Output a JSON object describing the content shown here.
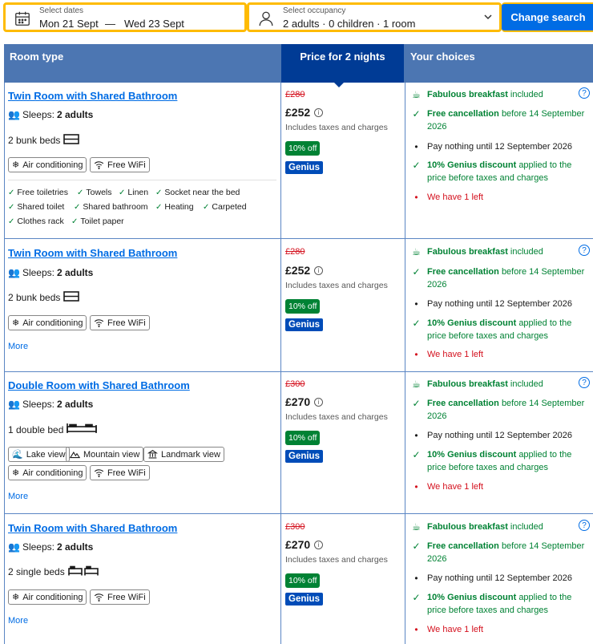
{
  "search": {
    "dates_label": "Select dates",
    "check_in": "Mon 21 Sept",
    "dash": "—",
    "check_out": "Wed 23 Sept",
    "occupancy_label": "Select occupancy",
    "occupancy_value": "2 adults · 0 children · 1 room",
    "button": "Change search"
  },
  "table": {
    "col_type": "Room type",
    "col_price": "Price for 2 nights",
    "col_choices": "Your choices"
  },
  "rooms": [
    {
      "name": "Twin Room with Shared Bathroom",
      "sleeps_label": "Sleeps:",
      "sleeps_value": "2 adults",
      "beds": "2 bunk beds",
      "badges": [
        "Air conditioning",
        "Free WiFi"
      ],
      "facilities": [
        "Free toiletries",
        "Towels",
        "Linen",
        "Socket near the bed",
        "Shared toilet",
        "Shared bathroom",
        "Heating",
        "Carpeted",
        "Clothes rack",
        "Toilet paper"
      ],
      "old_price": "£280",
      "price": "£252",
      "taxes": "Includes taxes and charges",
      "discount": "10% off",
      "genius": "Genius",
      "breakfast_bold": "Fabulous breakfast",
      "breakfast_rest": "included",
      "cancel_bold": "Free cancellation",
      "cancel_rest": "before 14 September 2026",
      "pay": "Pay nothing until 12 September 2026",
      "genius_bold": "10% Genius discount",
      "genius_rest": "applied to the price before taxes and charges",
      "left": "We have 1 left"
    },
    {
      "name": "Twin Room with Shared Bathroom",
      "sleeps_label": "Sleeps:",
      "sleeps_value": "2 adults",
      "beds": "2 bunk beds",
      "badges": [
        "Air conditioning",
        "Free WiFi"
      ],
      "more": "More",
      "old_price": "£280",
      "price": "£252",
      "taxes": "Includes taxes and charges",
      "discount": "10% off",
      "genius": "Genius",
      "breakfast_bold": "Fabulous breakfast",
      "breakfast_rest": "included",
      "cancel_bold": "Free cancellation",
      "cancel_rest": "before 14 September 2026",
      "pay": "Pay nothing until 12 September 2026",
      "genius_bold": "10% Genius discount",
      "genius_rest": "applied to the price before taxes and charges",
      "left": "We have 1 left"
    },
    {
      "name": "Double Room with Shared Bathroom",
      "sleeps_label": "Sleeps:",
      "sleeps_value": "2 adults",
      "beds": "1 double bed",
      "badges": [
        "Lake view",
        "Mountain view",
        "Landmark view",
        "Air conditioning",
        "Free WiFi"
      ],
      "more": "More",
      "old_price": "£300",
      "price": "£270",
      "taxes": "Includes taxes and charges",
      "discount": "10% off",
      "genius": "Genius",
      "breakfast_bold": "Fabulous breakfast",
      "breakfast_rest": "included",
      "cancel_bold": "Free cancellation",
      "cancel_rest": "before 14 September 2026",
      "pay": "Pay nothing until 12 September 2026",
      "genius_bold": "10% Genius discount",
      "genius_rest": "applied to the price before taxes and charges",
      "left": "We have 1 left"
    },
    {
      "name": "Twin Room with Shared Bathroom",
      "sleeps_label": "Sleeps:",
      "sleeps_value": "2 adults",
      "beds": "2 single beds",
      "badges": [
        "Air conditioning",
        "Free WiFi"
      ],
      "more": "More",
      "old_price": "£300",
      "price": "£270",
      "taxes": "Includes taxes and charges",
      "discount": "10% off",
      "genius": "Genius",
      "breakfast_bold": "Fabulous breakfast",
      "breakfast_rest": "included",
      "cancel_bold": "Free cancellation",
      "cancel_rest": "before 14 September 2026",
      "pay": "Pay nothing until 12 September 2026",
      "genius_bold": "10% Genius discount",
      "genius_rest": "applied to the price before taxes and charges",
      "left": "We have 1 left"
    }
  ],
  "colors": {
    "accent": "#006ce4",
    "header": "#4c76b2",
    "header_dark": "#003b95",
    "green": "#008234",
    "red": "#d4111e",
    "yellow": "#febb02"
  }
}
